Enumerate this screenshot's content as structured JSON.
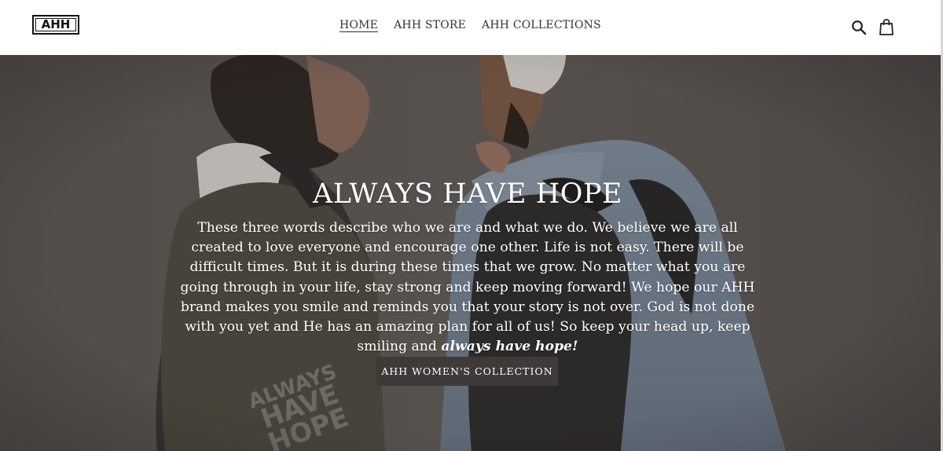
{
  "header": {
    "logo_text": "AHH",
    "nav": [
      {
        "label": "HOME",
        "active": true
      },
      {
        "label": "AHH STORE",
        "active": false
      },
      {
        "label": "AHH COLLECTIONS",
        "active": false
      }
    ],
    "icons": {
      "search": "search-icon",
      "cart": "shopping-bag-icon"
    }
  },
  "hero": {
    "title": "ALWAYS HAVE HOPE",
    "text_main": "These three words describe who we are and what we do. We believe we are all created to love everyone and encourage one other. Life is not easy. There will be difficult times. But it is during these times that we grow. No matter what you are going through in your life, stay strong and keep moving forward! We hope our AHH brand makes you smile and reminds you that your story is not over. God is not done with you yet and He has an amazing plan for all of us! So keep your head up, keep smiling and ",
    "text_emphasis": "always have hope!",
    "button_label": "AHH WOMEN'S COLLECTION",
    "backpack_print": "ALWAYS HAVE HOPE",
    "colors": {
      "overlay_text": "#ffffff",
      "button_bg": "#3e3a38"
    }
  }
}
